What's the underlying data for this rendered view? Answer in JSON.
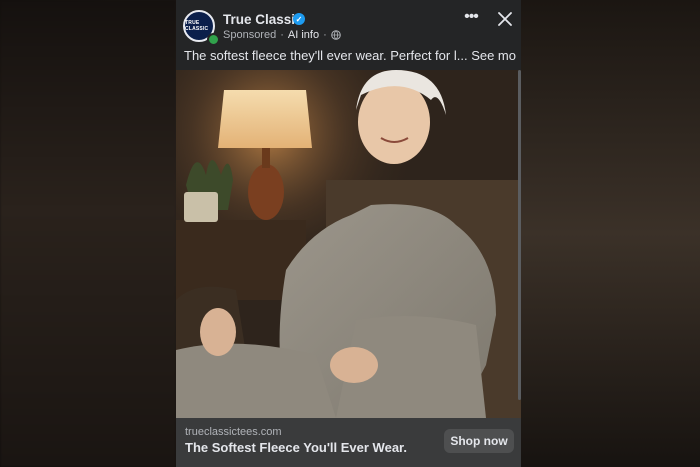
{
  "post": {
    "page_name": "True Classic",
    "avatar_text": "TRUE CLASSIC",
    "sponsored_label": "Sponsored",
    "separator": "·",
    "ai_info_label": "AI info",
    "caption_text": "The softest fleece they'll ever wear. Perfect for l...",
    "see_more_label": "See more"
  },
  "link_card": {
    "domain": "trueclassictees.com",
    "headline": "The Softest Fleece You'll Ever Wear.",
    "cta_label": "Shop now"
  },
  "colors": {
    "post_background": "#242526",
    "footer_background": "#3a3b3c",
    "verified_blue": "#1d9bf0",
    "online_green": "#31a24c",
    "primary_text": "#e4e6eb",
    "secondary_text": "#b0b3b8"
  },
  "icons": [
    "verified-badge-icon",
    "globe-icon",
    "more-options-icon",
    "close-icon"
  ]
}
